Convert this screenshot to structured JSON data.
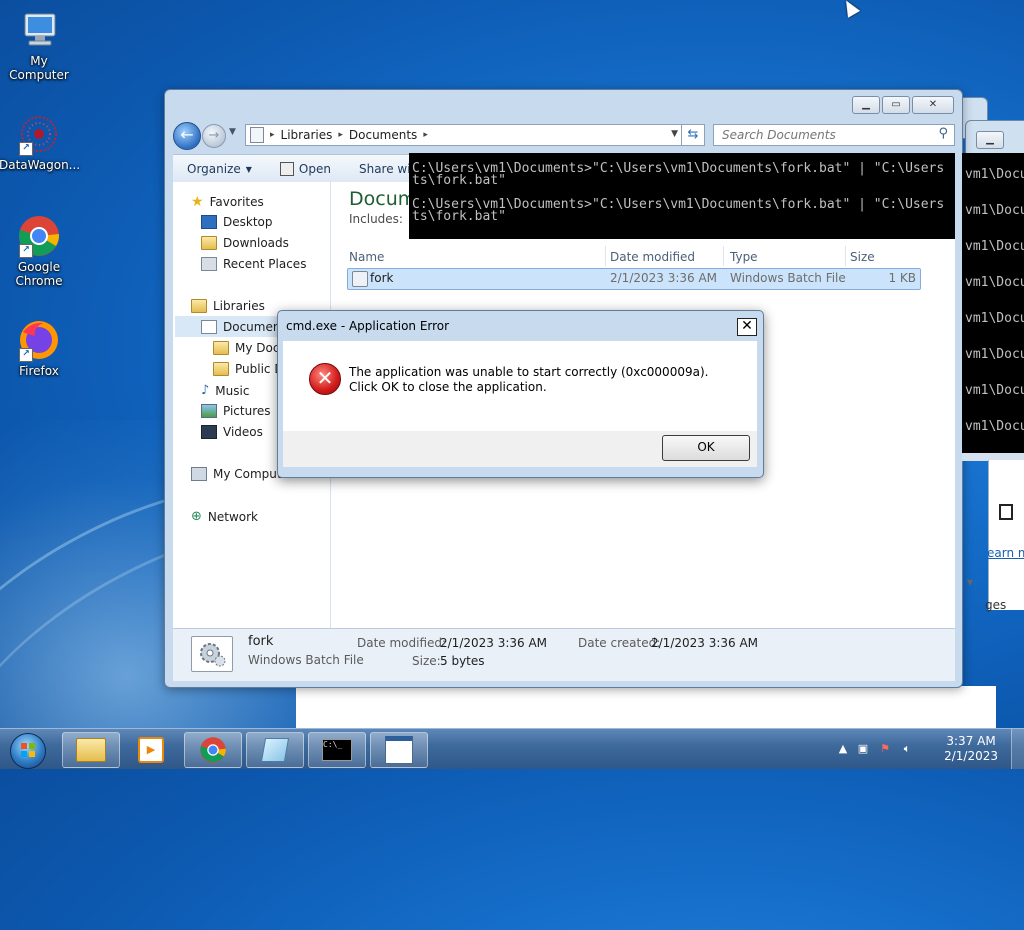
{
  "desktop": {
    "icons": [
      {
        "label": "My Computer",
        "icon": "computer-icon"
      },
      {
        "label": "DataWagon...",
        "icon": "datawagon-icon"
      },
      {
        "label": "Google Chrome",
        "icon": "chrome-icon"
      },
      {
        "label": "Firefox",
        "icon": "firefox-icon"
      }
    ]
  },
  "explorer": {
    "breadcrumb": [
      "Libraries",
      "Documents"
    ],
    "search_placeholder": "Search Documents",
    "toolbar": {
      "organize": "Organize",
      "open": "Open",
      "share": "Share wi"
    },
    "nav": {
      "favorites": "Favorites",
      "desktop": "Desktop",
      "downloads": "Downloads",
      "recent_places": "Recent Places",
      "libraries": "Libraries",
      "documents": "Documen",
      "my_documents": "My Docu",
      "public_documents": "Public D",
      "music": "Music",
      "pictures": "Pictures",
      "videos": "Videos",
      "my_computer": "My Computer",
      "network": "Network"
    },
    "heading": "Docum",
    "includes": "Includes:",
    "columns": {
      "name": "Name",
      "date_modified": "Date modified",
      "type": "Type",
      "size": "Size"
    },
    "files": [
      {
        "name": "fork",
        "date_modified": "2/1/2023 3:36 AM",
        "type": "Windows Batch File",
        "size": "1 KB"
      }
    ],
    "details": {
      "name": "fork",
      "type": "Windows Batch File",
      "date_modified_label": "Date modified:",
      "date_modified": "2/1/2023 3:36 AM",
      "size_label": "Size:",
      "size": "5 bytes",
      "date_created_label": "Date created:",
      "date_created": "2/1/2023 3:36 AM"
    }
  },
  "cmd": {
    "lines": [
      "C:\\Users\\vm1\\Documents>\"C:\\Users\\vm1\\Documents\\fork.bat\" | \"C:\\Users",
      "ts\\fork.bat\"",
      "",
      "C:\\Users\\vm1\\Documents>\"C:\\Users\\vm1\\Documents\\fork.bat\" | \"C:\\Users",
      "ts\\fork.bat\""
    ],
    "right_lines": [
      "vm1\\Docu",
      "vm1\\Docu",
      "vm1\\Docu",
      "vm1\\Docu",
      "vm1\\Docu",
      "vm1\\Docu",
      "vm1\\Docu",
      "vm1\\Docu"
    ]
  },
  "dialog": {
    "title": "cmd.exe - Application Error",
    "message": "The application was unable to start correctly (0xc000009a). Click OK to close the application.",
    "ok": "OK"
  },
  "right_window": {
    "link_text": "earn m",
    "partial_text": "ges"
  },
  "clock": {
    "time": "3:37 AM",
    "date": "2/1/2023"
  }
}
